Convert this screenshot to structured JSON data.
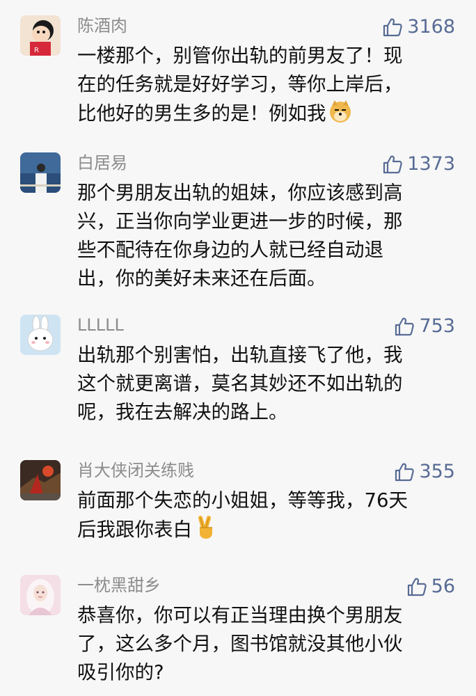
{
  "comments": [
    {
      "username": "陈酒肉",
      "likes": "3168",
      "content": "一楼那个，别管你出轨的前男友了！现\n在的任务就是好好学习，等你上岸后，\n比他好的男生多的是！例如我",
      "emoji": "doge-emoji"
    },
    {
      "username": "白居易",
      "likes": "1373",
      "content": "那个男朋友出轨的姐妹，你应该感到高\n兴，正当你向学业更进一步的时候，那\n些不配待在你身边的人就已经自动退\n出，你的美好未来还在后面。"
    },
    {
      "username": "LLLLL",
      "likes": "753",
      "content": "出轨那个别害怕，出轨直接飞了他，我\n这个就更离谱，莫名其妙还不如出轨的\n呢，我在去解决的路上。"
    },
    {
      "username": "肖大侠闭关练贱",
      "likes": "355",
      "content": "前面那个失恋的小姐姐，等等我，76天\n后我跟你表白",
      "emoji": "victory-hand-emoji"
    },
    {
      "username": "一枕黑甜乡",
      "likes": "56",
      "content": "恭喜你，你可以有正当理由换个男朋友\n了，这么多个月，图书馆就没其他小伙\n吸引你的?"
    }
  ],
  "colors": {
    "background": "#f7f7f7",
    "username": "#8c8c8c",
    "like": "#576b95",
    "text": "#111111"
  }
}
